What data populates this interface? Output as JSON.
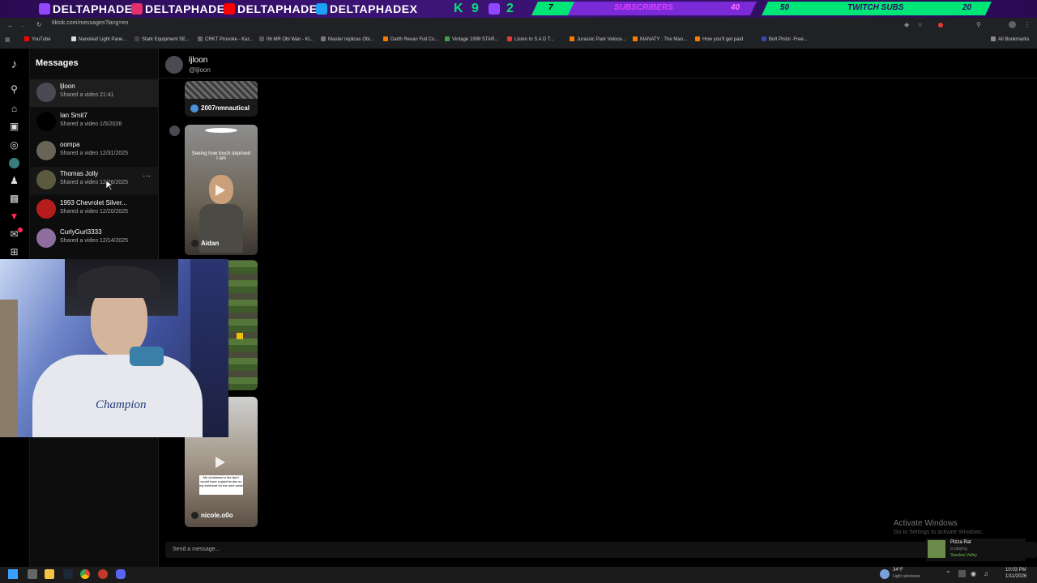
{
  "overlay": {
    "handles": [
      "DELTAPHADE",
      "DELTAPHADE",
      "DELTAPHADE",
      "DELTAPHADEX"
    ],
    "k_badge": "K",
    "k_count": "9",
    "twitch_count": "2",
    "goals": [
      {
        "left": "7",
        "label": "SUBSCRIBERS",
        "right": "40"
      },
      {
        "left": "50",
        "label": "TWITCH SUBS",
        "right": "20"
      }
    ]
  },
  "browser": {
    "url": "tiktok.com/messages?lang=en",
    "bookmarks": [
      "YouTube",
      "Nanoleaf Light Pane...",
      "Stark Equipment SE...",
      "CRKT Provoke - Kar...",
      "06 MR Obi Wan - Ki...",
      "Master replicas Obi...",
      "Darth Revan Full Co...",
      "Vintage 1999 STAR...",
      "Listen to S A D T...",
      "Jurassic Park Veloce...",
      "MANATY : The Man...",
      "How you'll get paid",
      "Bolt Pistol -Free..."
    ],
    "all_bookmarks": "All Bookmarks"
  },
  "messages": {
    "title": "Messages",
    "conversations": [
      {
        "name": "ljloon",
        "subtitle": "Shared a video 21:41"
      },
      {
        "name": "Ian Smit7",
        "subtitle": "Shared a video 1/5/2026"
      },
      {
        "name": "oompa",
        "subtitle": "Shared a video 12/31/2025"
      },
      {
        "name": "Thomas Jolly",
        "subtitle": "Shared a video 12/26/2025"
      },
      {
        "name": "1993 Chevrolet Silver...",
        "subtitle": "Shared a video 12/20/2025"
      },
      {
        "name": "CurlyGurl3333",
        "subtitle": "Shared a video 12/14/2025"
      }
    ],
    "more_icon": "···"
  },
  "chat": {
    "name": "ljloon",
    "handle": "@ljloon",
    "videos": [
      {
        "author": "2007nmnautical",
        "caption": ""
      },
      {
        "author": "Aidan",
        "caption": "Seeing how touch deprived I am"
      },
      {
        "author": "",
        "caption": ""
      },
      {
        "author": "nicole.o0o",
        "caption": "Me christmas to the fact I would have a giant bruise on my forehead for the next week"
      }
    ],
    "input_placeholder": "Send a message..."
  },
  "windows": {
    "activate_title": "Activate Windows",
    "activate_sub": "Go to Settings to activate Windows.",
    "now_playing_title": "Pizza Rat",
    "now_playing_status": "is playing",
    "now_playing_game": "Stardew Valley",
    "weather_temp": "34°F",
    "weather_desc": "Light rain/snow",
    "time": "10:03 PM",
    "date": "1/11/2026"
  },
  "webcam": {
    "shirt_text": "Champion"
  },
  "colors": {
    "overlay_green": "#00e676",
    "overlay_purple": "#7a2ad6",
    "tiktok_red": "#fe2c55"
  }
}
